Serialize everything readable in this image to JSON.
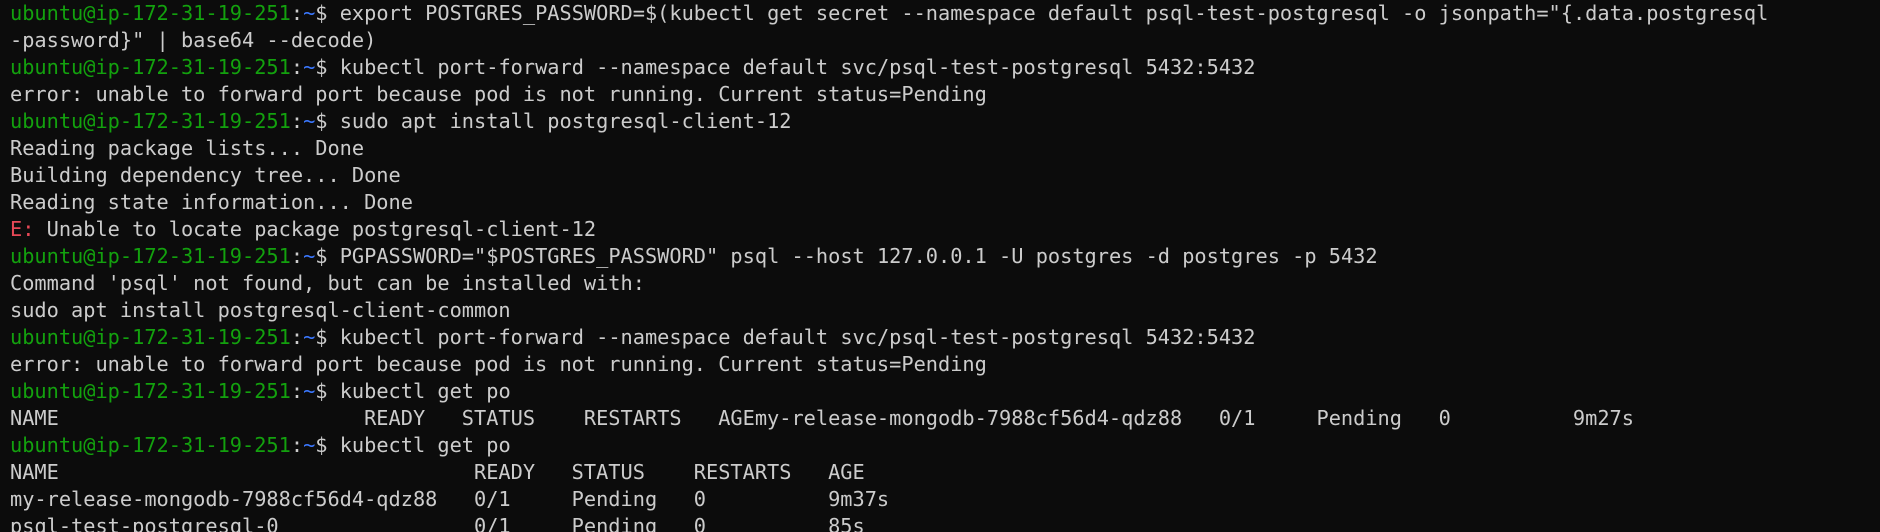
{
  "terminal": {
    "prompt": {
      "user_host": "ubuntu@ip-172-31-19-251",
      "separator": ":",
      "path": "~",
      "symbol": "$ "
    },
    "colors": {
      "background": "#0c0c0c",
      "foreground": "#cccccc",
      "prompt_user": "#13a10e",
      "prompt_path": "#3b78ff",
      "error_label": "#e74856"
    },
    "lines": [
      {
        "type": "cmd",
        "text": "export POSTGRES_PASSWORD=$(kubectl get secret --namespace default psql-test-postgresql -o jsonpath=\"{.data.postgresql"
      },
      {
        "type": "out",
        "text": "-password}\" | base64 --decode)"
      },
      {
        "type": "cmd",
        "text": "kubectl port-forward --namespace default svc/psql-test-postgresql 5432:5432"
      },
      {
        "type": "out",
        "text": "error: unable to forward port because pod is not running. Current status=Pending"
      },
      {
        "type": "cmd",
        "text": "sudo apt install postgresql-client-12"
      },
      {
        "type": "out",
        "text": "Reading package lists... Done"
      },
      {
        "type": "out",
        "text": "Building dependency tree... Done"
      },
      {
        "type": "out",
        "text": "Reading state information... Done"
      },
      {
        "type": "err",
        "label": "E:",
        "text": " Unable to locate package postgresql-client-12"
      },
      {
        "type": "cmd",
        "text": "PGPASSWORD=\"$POSTGRES_PASSWORD\" psql --host 127.0.0.1 -U postgres -d postgres -p 5432"
      },
      {
        "type": "out",
        "text": "Command 'psql' not found, but can be installed with:"
      },
      {
        "type": "out",
        "text": "sudo apt install postgresql-client-common"
      },
      {
        "type": "cmd",
        "text": "kubectl port-forward --namespace default svc/psql-test-postgresql 5432:5432"
      },
      {
        "type": "out",
        "text": "error: unable to forward port because pod is not running. Current status=Pending"
      },
      {
        "type": "cmd",
        "text": "kubectl get po"
      },
      {
        "type": "out",
        "text": "NAME                         READY   STATUS    RESTARTS   AGEmy-release-mongodb-7988cf56d4-qdz88   0/1     Pending   0          9m27s"
      },
      {
        "type": "cmd",
        "text": "kubectl get po"
      },
      {
        "type": "out",
        "text": "NAME                                  READY   STATUS    RESTARTS   AGE"
      },
      {
        "type": "out",
        "text": "my-release-mongodb-7988cf56d4-qdz88   0/1     Pending   0          9m37s"
      },
      {
        "type": "out",
        "text": "psql-test-postgresql-0                0/1     Pending   0          85s"
      }
    ]
  }
}
